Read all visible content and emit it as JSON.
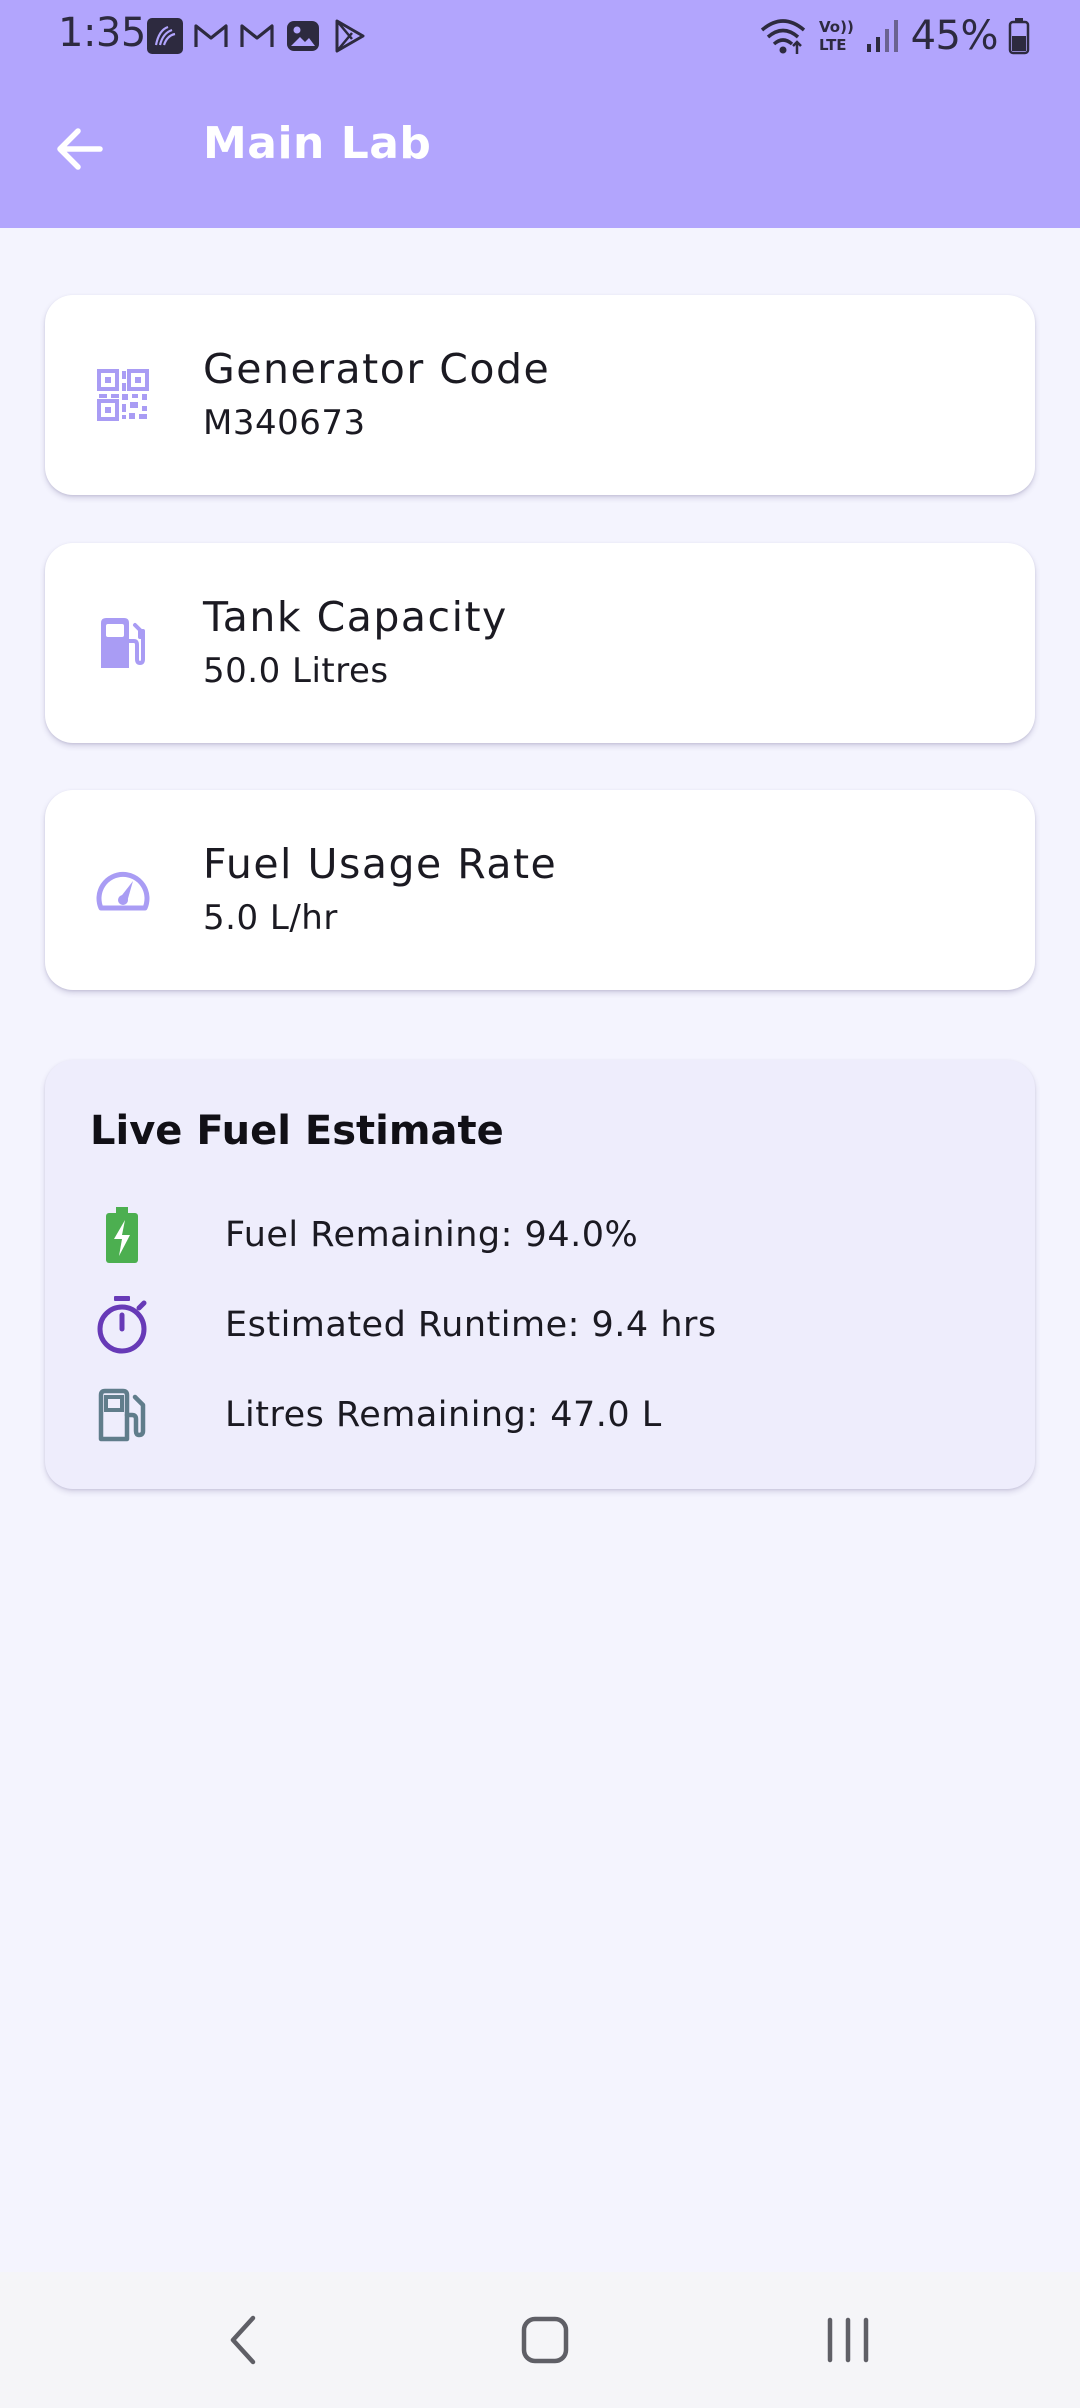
{
  "status_bar": {
    "time": "1:35",
    "battery_percent": "45%",
    "notification_icons": [
      "app-icon",
      "gmail-icon",
      "gmail-icon",
      "gallery-icon",
      "play-store-icon"
    ],
    "system_icons": [
      "wifi-icon",
      "volte-icon",
      "signal-icon",
      "battery-icon"
    ]
  },
  "app_bar": {
    "title": "Main Lab",
    "back_icon": "arrow-left-icon",
    "background": "#b2a5fd"
  },
  "cards": [
    {
      "icon": "qr-code-icon",
      "title": "Generator Code",
      "value": "M340673"
    },
    {
      "icon": "fuel-pump-icon",
      "title": "Tank Capacity",
      "value": "50.0 Litres"
    },
    {
      "icon": "speedometer-icon",
      "title": "Fuel Usage Rate",
      "value": "5.0 L/hr"
    }
  ],
  "estimate": {
    "title": "Live Fuel Estimate",
    "rows": [
      {
        "icon": "battery-charging-icon",
        "text": "Fuel Remaining: 94.0%"
      },
      {
        "icon": "timer-icon",
        "text": "Estimated Runtime: 9.4 hrs"
      },
      {
        "icon": "fuel-pump-outline-icon",
        "text": "Litres Remaining: 47.0 L"
      }
    ]
  },
  "nav_bar": {
    "buttons": [
      "back-nav-icon",
      "home-nav-icon",
      "recents-nav-icon"
    ]
  },
  "colors": {
    "accent": "#b2a5fd",
    "icon_purple": "#a99cf4",
    "battery_green": "#4caf50",
    "timer_purple": "#673ab7",
    "fuel_gray": "#607d8b",
    "background": "#f4f4fe"
  }
}
